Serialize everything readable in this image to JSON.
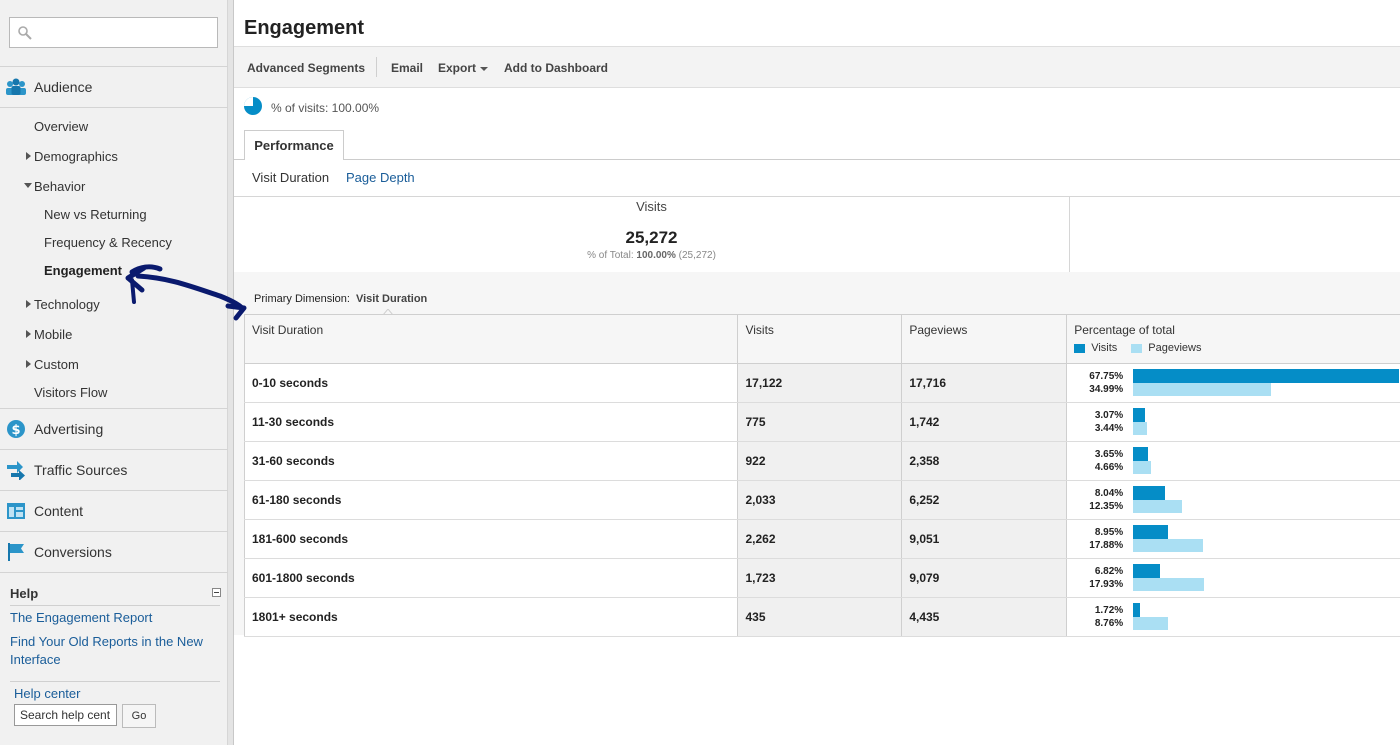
{
  "sidebar": {
    "search": {
      "value": "",
      "placeholder": ""
    },
    "sections": [
      {
        "label": "Audience",
        "icon": "people-icon"
      },
      {
        "label": "Advertising",
        "icon": "dollar-icon"
      },
      {
        "label": "Traffic Sources",
        "icon": "arrows-icon"
      },
      {
        "label": "Content",
        "icon": "content-icon"
      },
      {
        "label": "Conversions",
        "icon": "flag-icon"
      }
    ],
    "audience_items": {
      "overview": "Overview",
      "demographics": "Demographics",
      "behavior": "Behavior",
      "new_vs_returning": "New vs Returning",
      "frequency_recency": "Frequency & Recency",
      "engagement": "Engagement",
      "technology": "Technology",
      "mobile": "Mobile",
      "custom": "Custom",
      "visitors_flow": "Visitors Flow"
    },
    "help": {
      "title": "Help",
      "links": [
        "The Engagement Report",
        "Find Your Old Reports in the New Interface"
      ],
      "help_center": "Help center",
      "search_value": "Search help cent",
      "go_label": "Go"
    }
  },
  "main": {
    "title": "Engagement",
    "toolbar": {
      "advanced_segments": "Advanced Segments",
      "email": "Email",
      "export": "Export",
      "add_to_dashboard": "Add to Dashboard"
    },
    "segment_text": "% of visits: 100.00%",
    "tab": "Performance",
    "subtabs": {
      "visit_duration": "Visit Duration",
      "page_depth": "Page Depth"
    },
    "summary": {
      "label": "Visits",
      "value": "25,272",
      "sub_prefix": "% of Total:",
      "sub_pct": "100.00%",
      "sub_total": "(25,272)"
    },
    "primary_dimension": {
      "label": "Primary Dimension:",
      "value": "Visit Duration"
    },
    "table": {
      "headers": {
        "dimension": "Visit Duration",
        "visits": "Visits",
        "pageviews": "Pageviews",
        "pct": "Percentage of total"
      },
      "legend": {
        "visits": "Visits",
        "pageviews": "Pageviews"
      },
      "rows": [
        {
          "duration": "0-10 seconds",
          "visits": "17,122",
          "pageviews": "17,716",
          "visits_pct": "67.75%",
          "pageviews_pct": "34.99%",
          "v": 67.75,
          "p": 34.99
        },
        {
          "duration": "11-30 seconds",
          "visits": "775",
          "pageviews": "1,742",
          "visits_pct": "3.07%",
          "pageviews_pct": "3.44%",
          "v": 3.07,
          "p": 3.44
        },
        {
          "duration": "31-60 seconds",
          "visits": "922",
          "pageviews": "2,358",
          "visits_pct": "3.65%",
          "pageviews_pct": "4.66%",
          "v": 3.65,
          "p": 4.66
        },
        {
          "duration": "61-180 seconds",
          "visits": "2,033",
          "pageviews": "6,252",
          "visits_pct": "8.04%",
          "pageviews_pct": "12.35%",
          "v": 8.04,
          "p": 12.35
        },
        {
          "duration": "181-600 seconds",
          "visits": "2,262",
          "pageviews": "9,051",
          "visits_pct": "8.95%",
          "pageviews_pct": "17.88%",
          "v": 8.95,
          "p": 17.88
        },
        {
          "duration": "601-1800 seconds",
          "visits": "1,723",
          "pageviews": "9,079",
          "visits_pct": "6.82%",
          "pageviews_pct": "17.93%",
          "v": 6.82,
          "p": 17.93
        },
        {
          "duration": "1801+ seconds",
          "visits": "435",
          "pageviews": "4,435",
          "visits_pct": "1.72%",
          "pageviews_pct": "8.76%",
          "v": 1.72,
          "p": 8.76
        }
      ]
    }
  },
  "colors": {
    "visits": "#058dc7",
    "pageviews": "#aadff3",
    "link": "#1a5d99",
    "annotation": "#0a1a6e"
  }
}
